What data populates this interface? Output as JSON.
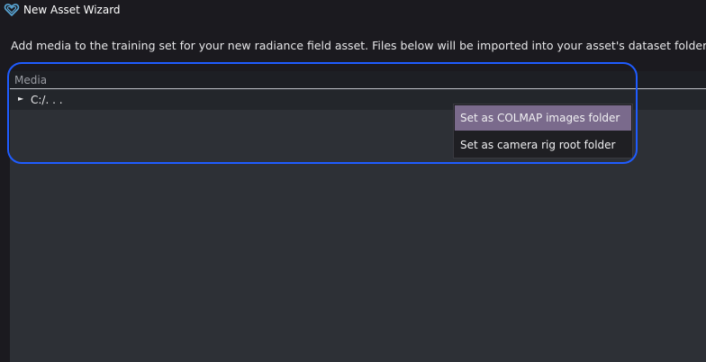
{
  "window": {
    "title": "New Asset Wizard",
    "icon": "heart-outline-icon"
  },
  "instructions": "Add media to the training set for your new radiance field asset. Files below will be imported into your asset's dataset folder.",
  "media_panel": {
    "header_label": "Media",
    "tree": [
      {
        "label": "C:/. . .",
        "expanded": false
      }
    ]
  },
  "context_menu": {
    "items": [
      {
        "label": "Set as COLMAP images folder",
        "highlighted": true
      },
      {
        "label": "Set as camera rig root folder",
        "highlighted": false
      }
    ]
  },
  "colors": {
    "accent_highlight_ring": "#1f5cff",
    "menu_hover": "#7a6a8c",
    "app_icon": "#5aa8d8"
  }
}
